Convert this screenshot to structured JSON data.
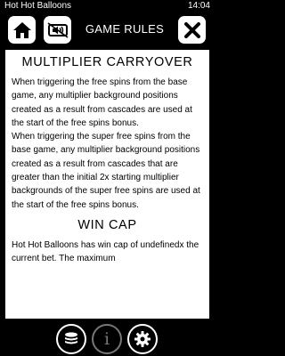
{
  "status_bar": {
    "app_title": "Hot Hot Balloons",
    "time": "14:04"
  },
  "header": {
    "title": "GAME RULES",
    "home_icon": "home-icon",
    "sound_icon": "sound-icon",
    "close_icon": "close-icon"
  },
  "sections": [
    {
      "title": "MULTIPLIER CARRYOVER",
      "paragraphs": [
        "When triggering the free spins from the base game, any multiplier background positions created as a result from cascades are used at the start of the free spins bonus.",
        "When triggering the super free spins from the base game, any multiplier background positions created as a result from cascades that are greater than the initial 2x starting multiplier backgrounds of the super free spins are used at the start of the free spins bonus."
      ]
    },
    {
      "title": "WIN CAP",
      "paragraphs": [
        "Hot Hot Balloons has win cap of undefinedx the current bet. The maximum"
      ]
    }
  ],
  "footer": {
    "stake_icon": "coin-stack-icon",
    "info_icon": "info-icon",
    "settings_icon": "gear-icon"
  },
  "colors": {
    "background": "#000000",
    "panel": "#ffffff",
    "text": "#000000",
    "inactive_icon": "#777777"
  }
}
